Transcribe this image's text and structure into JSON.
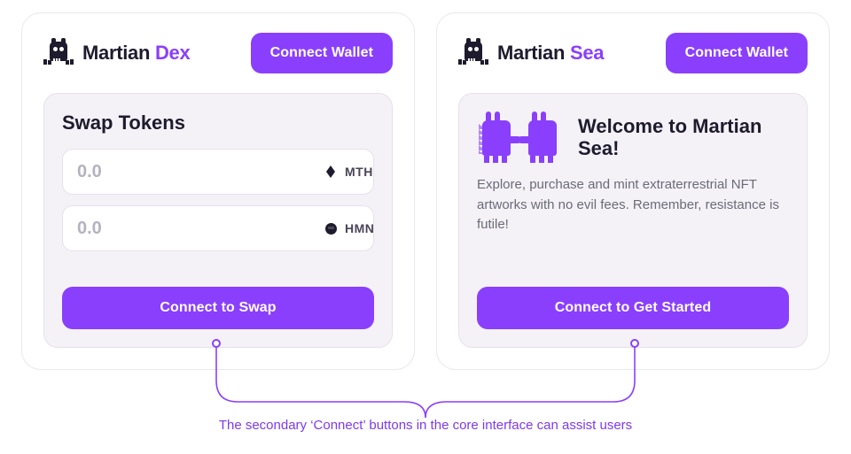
{
  "colors": {
    "purple": "#8A3FFC",
    "ink": "#1E1B2E"
  },
  "dex": {
    "brand_main": "Martian",
    "brand_accent": "Dex",
    "connect_label": "Connect Wallet",
    "panel_title": "Swap Tokens",
    "fields": [
      {
        "placeholder": "0.0",
        "token": "MTH",
        "icon": "mth-icon"
      },
      {
        "placeholder": "0.0",
        "token": "HMN",
        "icon": "hmn-icon"
      }
    ],
    "cta_label": "Connect to Swap"
  },
  "sea": {
    "brand_main": "Martian",
    "brand_accent": "Sea",
    "connect_label": "Connect Wallet",
    "hero_title": "Welcome to Martian Sea!",
    "hero_desc": "Explore, purchase and mint extraterrestrial NFT artworks with no evil fees. Remember, resistance is futile!",
    "cta_label": "Connect to Get Started"
  },
  "caption": "The secondary ‘Connect’ buttons in the core interface can assist users"
}
